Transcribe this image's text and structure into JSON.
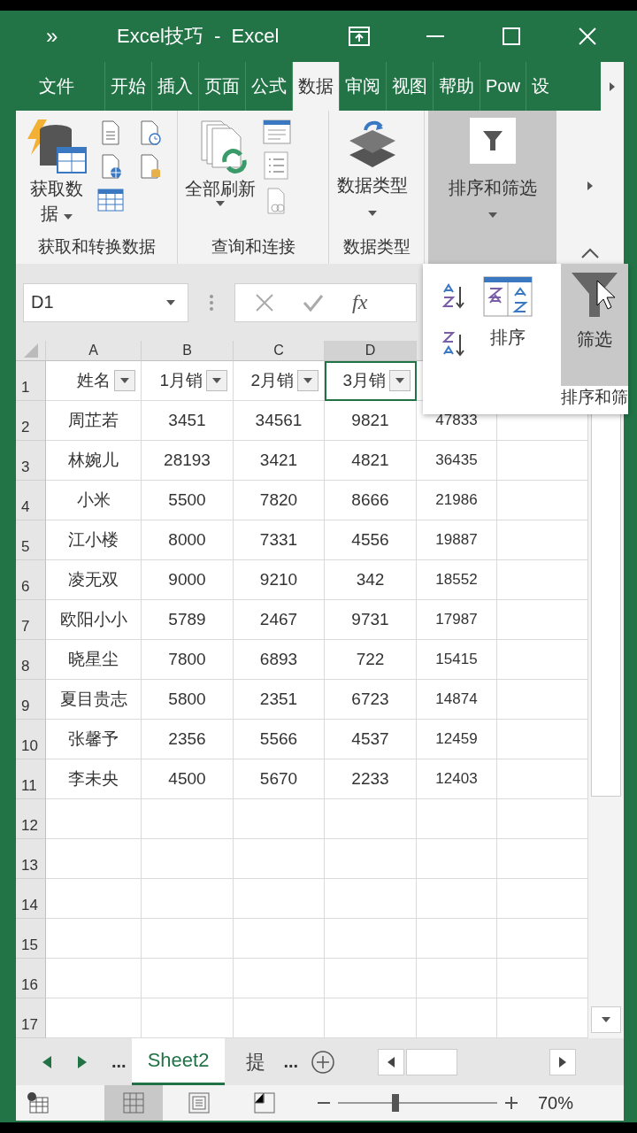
{
  "window": {
    "menu_glyph": "»",
    "title": "Excel技巧  -  Excel"
  },
  "tabs": [
    {
      "label": "文件",
      "selected": false
    },
    {
      "label": "开始",
      "selected": false
    },
    {
      "label": "插入",
      "selected": false
    },
    {
      "label": "页面",
      "selected": false
    },
    {
      "label": "公式",
      "selected": false
    },
    {
      "label": "数据",
      "selected": true
    },
    {
      "label": "审阅",
      "selected": false
    },
    {
      "label": "视图",
      "selected": false
    },
    {
      "label": "帮助",
      "selected": false
    },
    {
      "label": "Pow",
      "selected": false
    },
    {
      "label": "设",
      "selected": false
    }
  ],
  "ribbon": {
    "groups": [
      {
        "kind": "get-data",
        "button": "获取数据",
        "label": "获取和转换数据"
      },
      {
        "kind": "queries",
        "button": "全部刷新",
        "label": "查询和连接"
      },
      {
        "kind": "data-types",
        "button": "数据类型",
        "label": "数据类型"
      },
      {
        "kind": "collapsed",
        "button": "排序和筛选"
      }
    ]
  },
  "formula_bar": {
    "name_box": "D1",
    "fx": "fx"
  },
  "popup": {
    "buttons": [
      {
        "kind": "sort",
        "label": "排序",
        "selected": false
      },
      {
        "kind": "filter",
        "label": "筛选",
        "selected": true
      }
    ],
    "group_label": "排序和筛"
  },
  "grid": {
    "columns": [
      {
        "letter": "A",
        "selected": false
      },
      {
        "letter": "B",
        "selected": false
      },
      {
        "letter": "C",
        "selected": false
      },
      {
        "letter": "D",
        "selected": true
      }
    ],
    "rows": [
      {
        "number": "1",
        "cells": [
          {
            "text": "姓名",
            "selected": false
          },
          {
            "text": "1月销",
            "selected": false
          },
          {
            "text": "2月销",
            "selected": false
          },
          {
            "text": "3月销",
            "selected": true
          }
        ]
      },
      {
        "number": "2",
        "cells": [
          "周芷若",
          "3451",
          "34561",
          "9821",
          "47833"
        ]
      },
      {
        "number": "3",
        "cells": [
          "林婉儿",
          "28193",
          "3421",
          "4821",
          "36435"
        ]
      },
      {
        "number": "4",
        "cells": [
          "小米",
          "5500",
          "7820",
          "8666",
          "21986"
        ]
      },
      {
        "number": "5",
        "cells": [
          "江小楼",
          "8000",
          "7331",
          "4556",
          "19887"
        ]
      },
      {
        "number": "6",
        "cells": [
          "凌无双",
          "9000",
          "9210",
          "342",
          "18552"
        ]
      },
      {
        "number": "7",
        "cells": [
          "欧阳小小",
          "5789",
          "2467",
          "9731",
          "17987"
        ]
      },
      {
        "number": "8",
        "cells": [
          "晓星尘",
          "7800",
          "6893",
          "722",
          "15415"
        ]
      },
      {
        "number": "9",
        "cells": [
          "夏目贵志",
          "5800",
          "2351",
          "6723",
          "14874"
        ]
      },
      {
        "number": "10",
        "cells": [
          "张馨予",
          "2356",
          "5566",
          "4537",
          "12459"
        ]
      },
      {
        "number": "11",
        "cells": [
          "李未央",
          "4500",
          "5670",
          "2233",
          "12403"
        ]
      },
      {
        "number": "12"
      },
      {
        "number": "13"
      },
      {
        "number": "14"
      },
      {
        "number": "15"
      },
      {
        "number": "16"
      },
      {
        "number": "17"
      }
    ]
  },
  "sheet_tabs": {
    "more_left": "...",
    "tabs": [
      {
        "label": "Sheet2",
        "selected": true
      },
      {
        "label": "提",
        "selected": false
      }
    ],
    "more_right": "..."
  },
  "status_bar": {
    "views": [
      {
        "kind": "normal",
        "selected": true
      },
      {
        "kind": "page-layout",
        "selected": false
      },
      {
        "kind": "page-break",
        "selected": false
      }
    ],
    "zoom": {
      "level": 0.36,
      "reading": "70%"
    }
  }
}
